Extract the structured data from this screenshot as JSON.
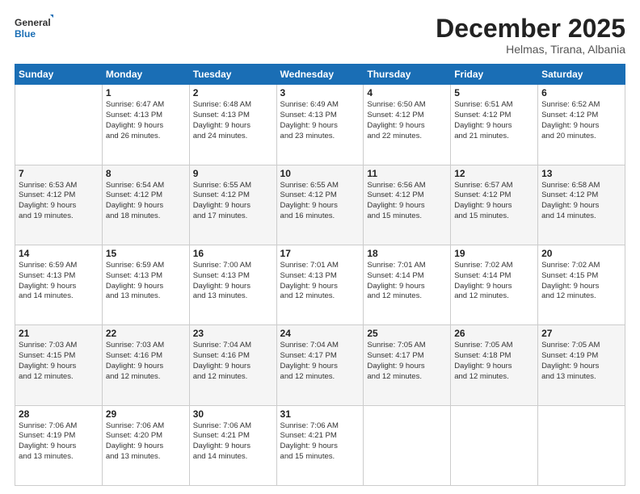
{
  "logo": {
    "line1": "General",
    "line2": "Blue"
  },
  "title": "December 2025",
  "subtitle": "Helmas, Tirana, Albania",
  "days_of_week": [
    "Sunday",
    "Monday",
    "Tuesday",
    "Wednesday",
    "Thursday",
    "Friday",
    "Saturday"
  ],
  "weeks": [
    [
      {
        "day": "",
        "info": ""
      },
      {
        "day": "1",
        "info": "Sunrise: 6:47 AM\nSunset: 4:13 PM\nDaylight: 9 hours\nand 26 minutes."
      },
      {
        "day": "2",
        "info": "Sunrise: 6:48 AM\nSunset: 4:13 PM\nDaylight: 9 hours\nand 24 minutes."
      },
      {
        "day": "3",
        "info": "Sunrise: 6:49 AM\nSunset: 4:13 PM\nDaylight: 9 hours\nand 23 minutes."
      },
      {
        "day": "4",
        "info": "Sunrise: 6:50 AM\nSunset: 4:12 PM\nDaylight: 9 hours\nand 22 minutes."
      },
      {
        "day": "5",
        "info": "Sunrise: 6:51 AM\nSunset: 4:12 PM\nDaylight: 9 hours\nand 21 minutes."
      },
      {
        "day": "6",
        "info": "Sunrise: 6:52 AM\nSunset: 4:12 PM\nDaylight: 9 hours\nand 20 minutes."
      }
    ],
    [
      {
        "day": "7",
        "info": "Sunrise: 6:53 AM\nSunset: 4:12 PM\nDaylight: 9 hours\nand 19 minutes."
      },
      {
        "day": "8",
        "info": "Sunrise: 6:54 AM\nSunset: 4:12 PM\nDaylight: 9 hours\nand 18 minutes."
      },
      {
        "day": "9",
        "info": "Sunrise: 6:55 AM\nSunset: 4:12 PM\nDaylight: 9 hours\nand 17 minutes."
      },
      {
        "day": "10",
        "info": "Sunrise: 6:55 AM\nSunset: 4:12 PM\nDaylight: 9 hours\nand 16 minutes."
      },
      {
        "day": "11",
        "info": "Sunrise: 6:56 AM\nSunset: 4:12 PM\nDaylight: 9 hours\nand 15 minutes."
      },
      {
        "day": "12",
        "info": "Sunrise: 6:57 AM\nSunset: 4:12 PM\nDaylight: 9 hours\nand 15 minutes."
      },
      {
        "day": "13",
        "info": "Sunrise: 6:58 AM\nSunset: 4:12 PM\nDaylight: 9 hours\nand 14 minutes."
      }
    ],
    [
      {
        "day": "14",
        "info": "Sunrise: 6:59 AM\nSunset: 4:13 PM\nDaylight: 9 hours\nand 14 minutes."
      },
      {
        "day": "15",
        "info": "Sunrise: 6:59 AM\nSunset: 4:13 PM\nDaylight: 9 hours\nand 13 minutes."
      },
      {
        "day": "16",
        "info": "Sunrise: 7:00 AM\nSunset: 4:13 PM\nDaylight: 9 hours\nand 13 minutes."
      },
      {
        "day": "17",
        "info": "Sunrise: 7:01 AM\nSunset: 4:13 PM\nDaylight: 9 hours\nand 12 minutes."
      },
      {
        "day": "18",
        "info": "Sunrise: 7:01 AM\nSunset: 4:14 PM\nDaylight: 9 hours\nand 12 minutes."
      },
      {
        "day": "19",
        "info": "Sunrise: 7:02 AM\nSunset: 4:14 PM\nDaylight: 9 hours\nand 12 minutes."
      },
      {
        "day": "20",
        "info": "Sunrise: 7:02 AM\nSunset: 4:15 PM\nDaylight: 9 hours\nand 12 minutes."
      }
    ],
    [
      {
        "day": "21",
        "info": "Sunrise: 7:03 AM\nSunset: 4:15 PM\nDaylight: 9 hours\nand 12 minutes."
      },
      {
        "day": "22",
        "info": "Sunrise: 7:03 AM\nSunset: 4:16 PM\nDaylight: 9 hours\nand 12 minutes."
      },
      {
        "day": "23",
        "info": "Sunrise: 7:04 AM\nSunset: 4:16 PM\nDaylight: 9 hours\nand 12 minutes."
      },
      {
        "day": "24",
        "info": "Sunrise: 7:04 AM\nSunset: 4:17 PM\nDaylight: 9 hours\nand 12 minutes."
      },
      {
        "day": "25",
        "info": "Sunrise: 7:05 AM\nSunset: 4:17 PM\nDaylight: 9 hours\nand 12 minutes."
      },
      {
        "day": "26",
        "info": "Sunrise: 7:05 AM\nSunset: 4:18 PM\nDaylight: 9 hours\nand 12 minutes."
      },
      {
        "day": "27",
        "info": "Sunrise: 7:05 AM\nSunset: 4:19 PM\nDaylight: 9 hours\nand 13 minutes."
      }
    ],
    [
      {
        "day": "28",
        "info": "Sunrise: 7:06 AM\nSunset: 4:19 PM\nDaylight: 9 hours\nand 13 minutes."
      },
      {
        "day": "29",
        "info": "Sunrise: 7:06 AM\nSunset: 4:20 PM\nDaylight: 9 hours\nand 13 minutes."
      },
      {
        "day": "30",
        "info": "Sunrise: 7:06 AM\nSunset: 4:21 PM\nDaylight: 9 hours\nand 14 minutes."
      },
      {
        "day": "31",
        "info": "Sunrise: 7:06 AM\nSunset: 4:21 PM\nDaylight: 9 hours\nand 15 minutes."
      },
      {
        "day": "",
        "info": ""
      },
      {
        "day": "",
        "info": ""
      },
      {
        "day": "",
        "info": ""
      }
    ]
  ]
}
